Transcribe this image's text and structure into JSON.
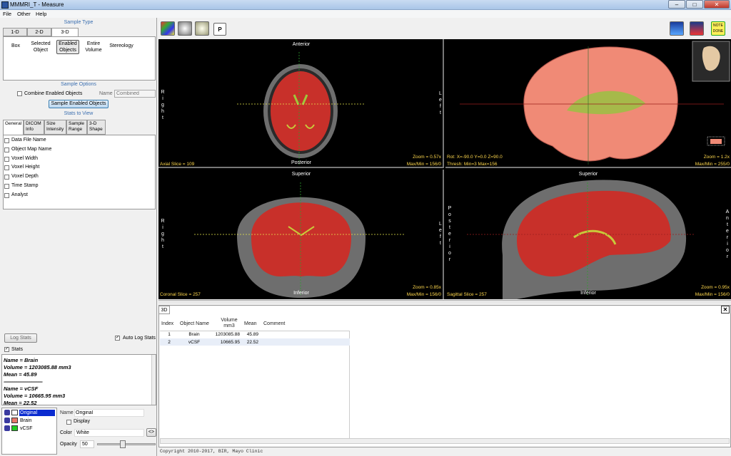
{
  "window": {
    "title": "MMMRI_T - Measure",
    "minimize": "–",
    "maximize": "□",
    "close": "✕"
  },
  "menu": [
    "File",
    "Other",
    "Help"
  ],
  "sample_type": {
    "title": "Sample Type",
    "tabs": [
      "1-D",
      "2-D",
      "3-D"
    ],
    "active_tab": "3-D",
    "options": [
      [
        "Box",
        ""
      ],
      [
        "Selected",
        "Object"
      ],
      [
        "Enabled",
        "Objects"
      ],
      [
        "Entire",
        "Volume"
      ],
      [
        "Stereology",
        ""
      ]
    ]
  },
  "sample_options": {
    "title": "Sample Options",
    "combine_label": "Combine Enabled Objects",
    "name_label": "Name",
    "name_placeholder": "Combined",
    "button": "Sample Enabled Objects"
  },
  "stats_view": {
    "title": "Stats to View",
    "tabs": [
      [
        "General",
        ""
      ],
      [
        "DICOM",
        "Info"
      ],
      [
        "Size",
        "Intensity"
      ],
      [
        "Sample",
        "Range"
      ],
      [
        "3-D",
        "Shape"
      ]
    ],
    "items": [
      "Data File Name",
      "Object Map Name",
      "Voxel Width",
      "Voxel Height",
      "Voxel Depth",
      "Time Stamp",
      "Analyst"
    ]
  },
  "log": {
    "log_button": "Log Stats",
    "auto_label": "Auto Log Stats",
    "stats_label": "Stats",
    "lines": [
      "Name = Brain",
      "Volume = 1203085.88 mm3",
      "Mean = 45.89",
      "------------------------------------",
      "Name = vCSF",
      "Volume = 10665.95 mm3",
      "Mean = 22.52"
    ]
  },
  "objects": {
    "list": [
      {
        "name": "Original",
        "color": "#ffffff"
      },
      {
        "name": "Brain",
        "color": "#e8776a"
      },
      {
        "name": "vCSF",
        "color": "#22cc22"
      }
    ],
    "name_label": "Name",
    "name_value": "Original",
    "display_label": "Display",
    "color_label": "Color",
    "color_value": "White",
    "opacity_label": "Opacity",
    "opacity_value": "50",
    "picker_glyph": "<>"
  },
  "toolbar_right": {
    "notes": "NOTE\nDONE"
  },
  "viewports": {
    "axial": {
      "top": "Anterior",
      "bottom": "Posterior",
      "left": "Right",
      "right": "Left",
      "slice": "Axial Slice = 109",
      "zoom": "Zoom = 0.57x",
      "maxmin": "Max/Min = 156/0"
    },
    "render": {
      "rot": "Rot: X=-90.0 Y=0.0 Z=90.0",
      "thresh": "Thresh: Min=3 Max=156",
      "zoom": "Zoom = 1.2x",
      "maxmin": "Max/Min = 255/0"
    },
    "coronal": {
      "top": "Superior",
      "bottom": "Inferior",
      "left": "Right",
      "right": "Left",
      "slice": "Coronal Slice = 257",
      "zoom": "Zoom = 0.85x",
      "maxmin": "Max/Min = 156/0"
    },
    "sagittal": {
      "top": "Superior",
      "bottom": "Inferior",
      "left": "Posterior",
      "right": "Anterior",
      "slice": "Sagittal Slice = 257",
      "zoom": "Zoom = 0.95x",
      "maxmin": "Max/Min = 156/0"
    }
  },
  "results": {
    "tab": "3D",
    "close": "✕",
    "headers": [
      "Index",
      "Object Name",
      "Volume\nmm3",
      "Mean",
      "Comment"
    ],
    "rows": [
      [
        "1",
        "Brain",
        "1203085.88",
        "45.89",
        ""
      ],
      [
        "2",
        "vCSF",
        "10665.95",
        "22.52",
        ""
      ]
    ]
  },
  "footer": "Copyright 2010-2017, BIR, Mayo Clinic"
}
